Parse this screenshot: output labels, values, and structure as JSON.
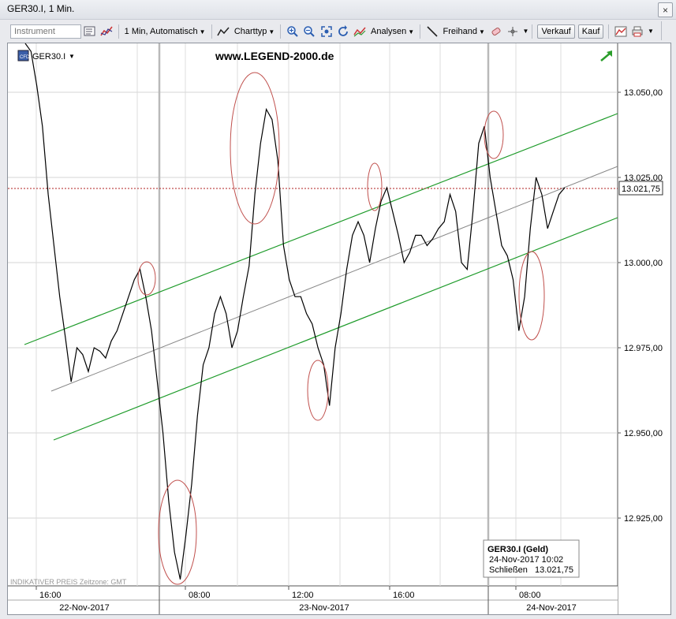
{
  "window": {
    "title": "GER30.I, 1 Min.",
    "close_glyph": "×"
  },
  "toolbar": {
    "instrument_placeholder": "Instrument",
    "interval_label": "1 Min, Automatisch",
    "charttype_label": "Charttyp",
    "analysis_label": "Analysen",
    "freehand_label": "Freihand",
    "sell_label": "Verkauf",
    "buy_label": "Kauf"
  },
  "chart": {
    "instrument_label": "GER30.I",
    "watermark": "www.LEGEND-2000.de",
    "footer_note": "INDIKATIVER PREIS   Zeitzone: GMT",
    "price_tag": "13.021,75",
    "colors": {
      "price": "#000000",
      "channel": "#1e9b2a",
      "midline": "#888888",
      "circle": "#c0504d",
      "ref_line": "#b22222"
    },
    "icons": [
      "cfd-badge-icon",
      "dropdown-arrow-icon",
      "trend-arrow-icon"
    ]
  },
  "info_box": {
    "title": "GER30.I (Geld)",
    "date": "24-Nov-2017 10:02",
    "close_label": "Schließen",
    "close_value": "13.021,75"
  },
  "chart_data": {
    "type": "line",
    "title": "",
    "y_ticks": [
      "13.050,00",
      "13.025,00",
      "13.000,00",
      "12.975,00",
      "12.950,00",
      "12.925,00"
    ],
    "ylim": [
      12906,
      13070
    ],
    "x_ticks": [
      "16:00",
      "08:00",
      "12:00",
      "16:00",
      "08:00"
    ],
    "day_labels": [
      "22-Nov-2017",
      "23-Nov-2017",
      "24-Nov-2017"
    ],
    "last_value": 13021.75,
    "series": [
      {
        "values": [
          13080,
          13062,
          13052,
          13040,
          13020,
          13005,
          12990,
          12978,
          12965,
          12975,
          12973,
          12968,
          12975,
          12974,
          12972,
          12977,
          12980,
          12985,
          12990,
          12995,
          12998,
          12990,
          12980,
          12965,
          12950,
          12930,
          12915,
          12907,
          12920,
          12935,
          12955,
          12970,
          12975,
          12985,
          12990,
          12985,
          12975,
          12980,
          12990,
          12999,
          13020,
          13035,
          13045,
          13042,
          13030,
          13005,
          12995,
          12990,
          12990,
          12985,
          12982,
          12975,
          12970,
          12958,
          12975,
          12985,
          12998,
          13008,
          13012,
          13008,
          13000,
          13010,
          13018,
          13022,
          13015,
          13008,
          13000,
          13003,
          13008,
          13008,
          13005,
          13007,
          13010,
          13012,
          13020,
          13015,
          13000,
          12998,
          13015,
          13035,
          13040,
          13025,
          13015,
          13005,
          13002,
          12995,
          12980,
          12990,
          13010,
          13025,
          13020,
          13010,
          13015,
          13020,
          13022
        ]
      }
    ]
  }
}
